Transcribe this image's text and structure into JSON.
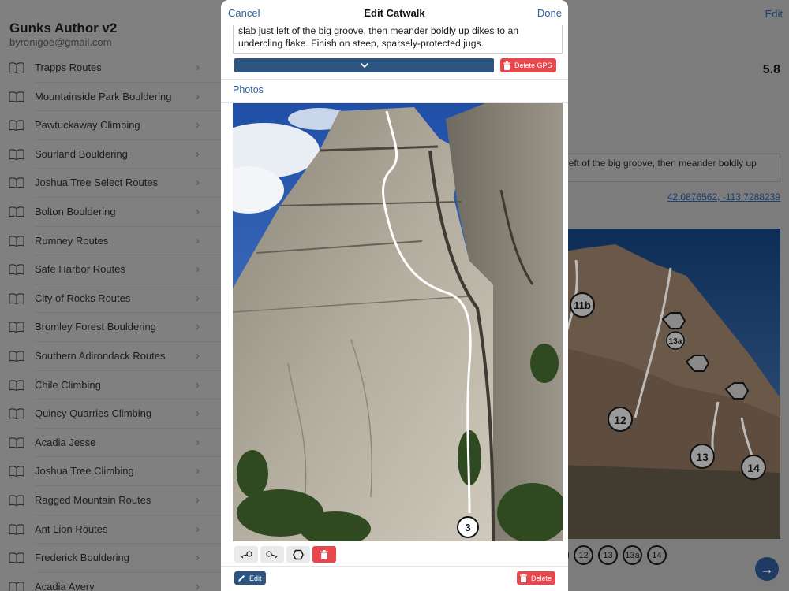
{
  "sidebar": {
    "title": "Gunks Author v2",
    "email": "byronigoe@gmail.com",
    "items": [
      {
        "label": "Trapps Routes"
      },
      {
        "label": "Mountainside Park Bouldering"
      },
      {
        "label": "Pawtuckaway Climbing"
      },
      {
        "label": "Sourland Bouldering"
      },
      {
        "label": "Joshua Tree Select Routes"
      },
      {
        "label": "Bolton Bouldering"
      },
      {
        "label": "Rumney Routes"
      },
      {
        "label": "Safe Harbor Routes"
      },
      {
        "label": "City of Rocks Routes"
      },
      {
        "label": "Bromley Forest Bouldering"
      },
      {
        "label": "Southern Adirondack Routes"
      },
      {
        "label": "Chile Climbing"
      },
      {
        "label": "Quincy Quarries Climbing"
      },
      {
        "label": "Acadia Jesse"
      },
      {
        "label": "Joshua Tree Climbing"
      },
      {
        "label": "Ragged Mountain Routes"
      },
      {
        "label": "Ant Lion Routes"
      },
      {
        "label": "Frederick Bouldering"
      },
      {
        "label": "Acadia Avery"
      }
    ],
    "item_icon": "book-icon",
    "chevron_icon": "chevron-right-icon"
  },
  "detail": {
    "edit_label": "Edit",
    "grade": "5.8",
    "description": "left of the big groove, then meander boldly up",
    "coordinates": "42.0876562, -113.7288239",
    "route_markers": [
      "11b",
      "12",
      "13a",
      "13",
      "14"
    ],
    "chips": [
      "b",
      "12",
      "13",
      "13a",
      "14"
    ],
    "next_icon": "arrow-right-icon"
  },
  "modal": {
    "cancel_label": "Cancel",
    "title": "Edit Catwalk",
    "done_label": "Done",
    "description": "slab just left of the big groove, then meander boldly up dikes to an undercling flake. Finish on steep, sparsely-protected jugs.",
    "gps_dropdown_icon": "chevron-down-icon",
    "delete_gps_label": "Delete GPS",
    "photos_label": "Photos",
    "route_marker": "3",
    "tools": [
      "line-start-icon",
      "line-end-icon",
      "hexagon-icon",
      "trash-icon"
    ],
    "edit_label": "Edit",
    "delete_label": "Delete"
  },
  "colors": {
    "accent": "#2d5e9b",
    "button_blue": "#2d5580",
    "danger": "#e6484e",
    "overlay": "#7c7c7c"
  }
}
